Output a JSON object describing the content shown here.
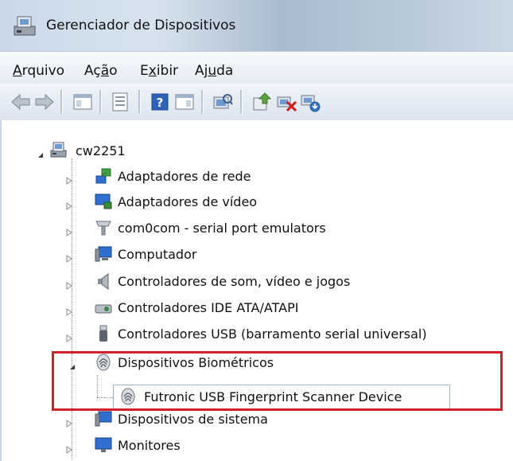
{
  "window": {
    "title": "Gerenciador de Dispositivos"
  },
  "menu": {
    "items": [
      {
        "label": "Arquivo",
        "accel_key": "A"
      },
      {
        "label": "Ação",
        "accel_key": "o"
      },
      {
        "label": "Exibir",
        "accel_key": "x"
      },
      {
        "label": "Ajuda",
        "accel_key": "u"
      }
    ]
  },
  "toolbar": {
    "buttons": [
      "back-arrow-icon",
      "forward-arrow-icon",
      "console-tree-icon",
      "properties-icon",
      "help-icon",
      "action-pane-icon",
      "scan-hardware-icon",
      "update-driver-icon",
      "uninstall-icon",
      "enable-device-icon"
    ]
  },
  "tree": {
    "root": {
      "label": "cw2251",
      "expanded": true
    },
    "categories": [
      {
        "label": "Adaptadores de rede",
        "icon": "network-adapter-icon",
        "expanded": false
      },
      {
        "label": "Adaptadores de vídeo",
        "icon": "display-adapter-icon",
        "expanded": false
      },
      {
        "label": "com0com - serial port emulators",
        "icon": "serial-port-icon",
        "expanded": false
      },
      {
        "label": "Computador",
        "icon": "computer-icon",
        "expanded": false
      },
      {
        "label": "Controladores de som, vídeo e jogos",
        "icon": "speaker-icon",
        "expanded": false
      },
      {
        "label": "Controladores IDE ATA/ATAPI",
        "icon": "ide-controller-icon",
        "expanded": false
      },
      {
        "label": "Controladores USB (barramento serial universal)",
        "icon": "usb-icon",
        "expanded": false
      },
      {
        "label": "Dispositivos Biométricos",
        "icon": "fingerprint-icon",
        "expanded": true
      },
      {
        "label": "Dispositivos de sistema",
        "icon": "system-device-icon",
        "expanded": false
      },
      {
        "label": "Monitores",
        "icon": "monitor-icon",
        "expanded": false
      }
    ],
    "selected_device": {
      "label": "Futronic USB Fingerprint Scanner Device",
      "icon": "fingerprint-icon"
    }
  },
  "colors": {
    "highlight_frame": "#d3212a",
    "selection_border": "#a0b4c9"
  }
}
